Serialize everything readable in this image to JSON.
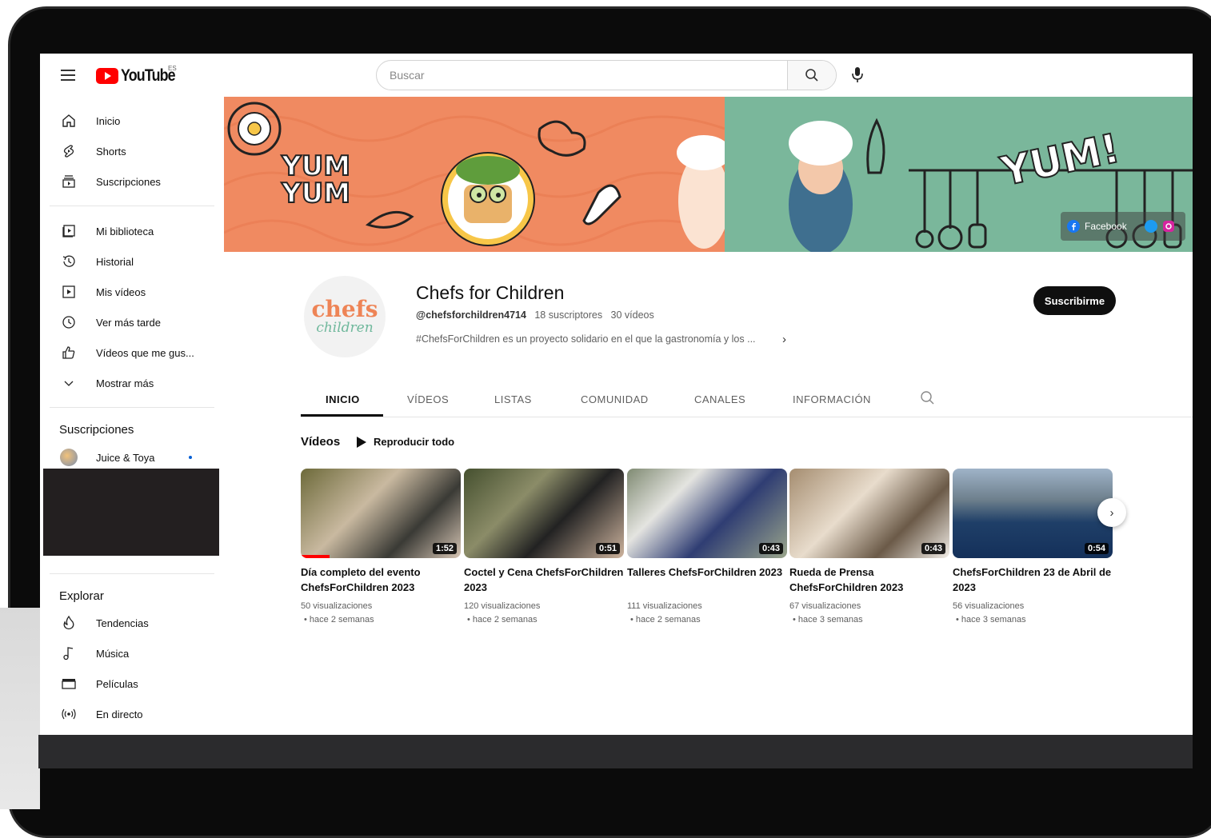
{
  "header": {
    "logo_text": "YouTube",
    "logo_region": "ES",
    "search_placeholder": "Buscar"
  },
  "sidebar": {
    "main": [
      {
        "label": "Inicio",
        "icon": "home-icon"
      },
      {
        "label": "Shorts",
        "icon": "shorts-icon"
      },
      {
        "label": "Suscripciones",
        "icon": "subscriptions-icon"
      }
    ],
    "library": [
      {
        "label": "Mi biblioteca",
        "icon": "library-icon"
      },
      {
        "label": "Historial",
        "icon": "history-icon"
      },
      {
        "label": "Mis vídeos",
        "icon": "my-videos-icon"
      },
      {
        "label": "Ver más tarde",
        "icon": "watch-later-icon"
      },
      {
        "label": "Vídeos que me gus...",
        "icon": "like-icon"
      },
      {
        "label": "Mostrar más",
        "icon": "chevron-down-icon"
      }
    ],
    "subscriptions_title": "Suscripciones",
    "subscriptions": [
      {
        "label": "Juice & Toya"
      }
    ],
    "explore_title": "Explorar",
    "explore": [
      {
        "label": "Tendencias",
        "icon": "trending-icon"
      },
      {
        "label": "Música",
        "icon": "music-icon"
      },
      {
        "label": "Películas",
        "icon": "movies-icon"
      },
      {
        "label": "En directo",
        "icon": "live-icon"
      }
    ]
  },
  "banner": {
    "text_left": "YUM YUM",
    "text_right": "YUM!",
    "facebook_label": "Facebook"
  },
  "channel": {
    "avatar_line1": "chefs",
    "avatar_line2": "children",
    "name": "Chefs for Children",
    "handle": "@chefsforchildren4714",
    "subscribers": "18 suscriptores",
    "videos_count": "30 vídeos",
    "description": "#ChefsForChildren es un proyecto solidario en el que la gastronomía y los ...",
    "subscribe_label": "Suscribirme"
  },
  "tabs": [
    "INICIO",
    "VÍDEOS",
    "LISTAS",
    "COMUNIDAD",
    "CANALES",
    "INFORMACIÓN"
  ],
  "videos_section": {
    "title": "Vídeos",
    "play_all": "Reproducir todo",
    "items": [
      {
        "title": "Día completo del evento ChefsForChildren 2023",
        "duration": "1:52",
        "views": "50 visualizaciones",
        "time": "• hace 2 semanas"
      },
      {
        "title": "Coctel y Cena ChefsForChildren 2023",
        "duration": "0:51",
        "views": "120 visualizaciones",
        "time": "• hace 2 semanas"
      },
      {
        "title": "Talleres ChefsForChildren 2023",
        "duration": "0:43",
        "views": "111 visualizaciones",
        "time": "• hace 2 semanas"
      },
      {
        "title": "Rueda de Prensa ChefsForChildren 2023",
        "duration": "0:43",
        "views": "67 visualizaciones",
        "time": "• hace 3 semanas"
      },
      {
        "title": "ChefsForChildren 23 de Abril de 2023",
        "duration": "0:54",
        "views": "56 visualizaciones",
        "time": "• hace 3 semanas"
      }
    ]
  }
}
